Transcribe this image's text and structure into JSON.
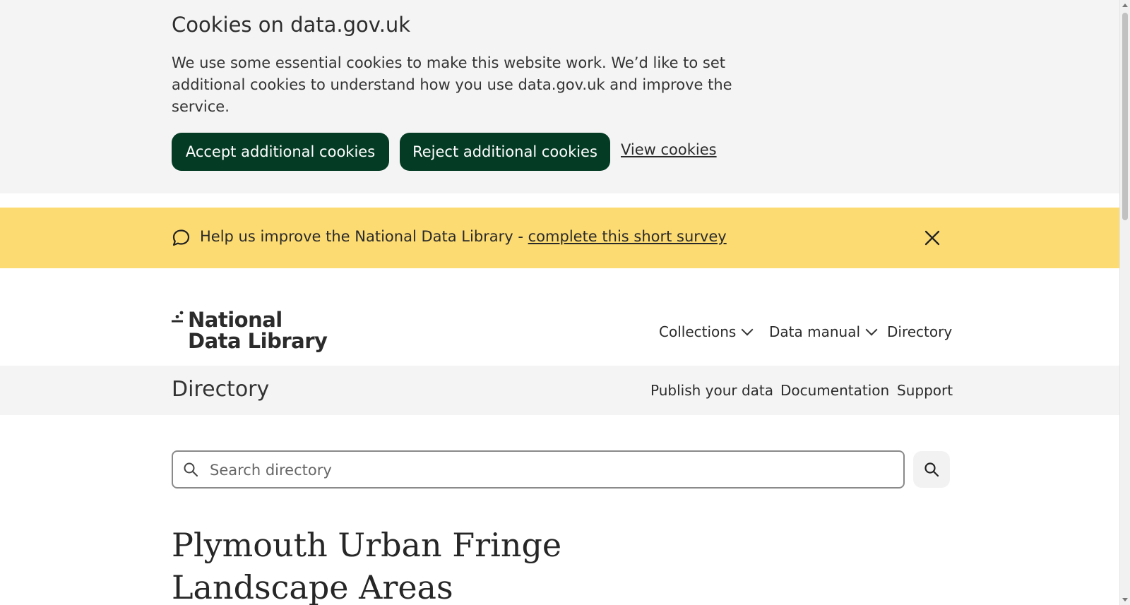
{
  "cookie_banner": {
    "title": "Cookies on data.gov.uk",
    "body": "We use some essential cookies to make this website work. We’d like to set additional cookies to understand how you use data.gov.uk and improve the service.",
    "accept_label": "Accept additional cookies",
    "reject_label": "Reject additional cookies",
    "view_label": "View cookies",
    "accent_color": "#043b24"
  },
  "survey_banner": {
    "text": "Help us improve the National Data Library - ",
    "link": "complete this short survey",
    "icon": "speech-bubble-icon",
    "close_icon": "close-icon",
    "background": "#fddb73"
  },
  "header": {
    "logo_line1": "National",
    "logo_line2": "Data Library",
    "nav": {
      "collections": "Collections",
      "data_manual": "Data manual",
      "directory": "Directory"
    }
  },
  "subnav": {
    "title": "Directory",
    "publish": "Publish your data",
    "documentation": "Documentation",
    "support": "Support"
  },
  "search": {
    "placeholder": "Search directory",
    "icon": "search-icon"
  },
  "main": {
    "title": "Plymouth Urban Fringe Landscape Areas"
  }
}
